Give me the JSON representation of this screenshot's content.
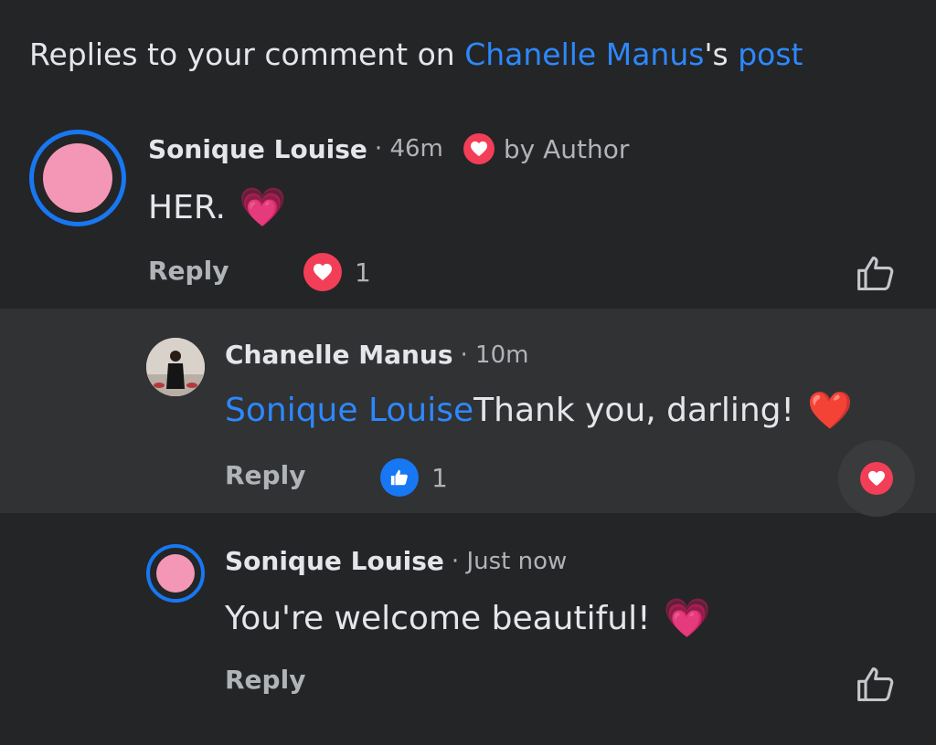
{
  "header": {
    "prefix": "Replies to your comment on ",
    "author_link": "Chanelle Manus",
    "possessive": "'s ",
    "post_link": "post"
  },
  "comments": [
    {
      "name": "Sonique Louise",
      "time": "· 46m",
      "badge_label": "by Author",
      "text": "HER.",
      "emoji": "💗",
      "reply_label": "Reply",
      "reaction_icon": "heart-reaction-icon",
      "reaction_count": "1"
    },
    {
      "name": "Chanelle Manus",
      "time": "· 10m",
      "mention": "Sonique Louise",
      "text": " Thank you, darling!",
      "emoji": "❤️",
      "reply_label": "Reply",
      "reaction_icon": "like-reaction-icon",
      "reaction_count": "1"
    },
    {
      "name": "Sonique Louise",
      "time": "· Just now",
      "text": "You're welcome beautiful!",
      "emoji": "💗",
      "reply_label": "Reply"
    }
  ],
  "colors": {
    "background": "#242526",
    "highlight_row": "#313233",
    "link": "#2d88ff",
    "heart": "#f33e58",
    "like": "#1877f2",
    "avatar_pink": "#f497b6"
  }
}
